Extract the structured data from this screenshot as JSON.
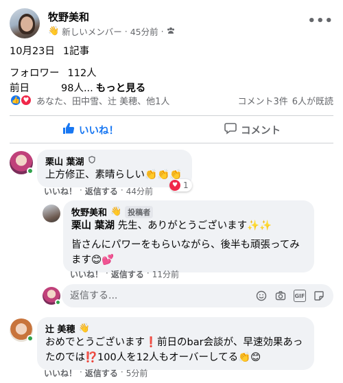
{
  "post": {
    "author": "牧野美和",
    "meta": {
      "member_label": "新しいメンバー",
      "time": "45分前"
    },
    "body": {
      "date": "10月23日",
      "count": "1記事",
      "followers_label": "フォロワー",
      "followers_value": "112人",
      "prev_label": "前日",
      "prev_value": "98人...",
      "see_more": "もっと見る"
    },
    "reactions": {
      "names": "あなた、田中雪、辻 美穂、他1人",
      "comments": "コメント3件",
      "seen": "6人が既読"
    },
    "actions": {
      "like": "いいね！",
      "comment": "コメント"
    }
  },
  "comments": [
    {
      "name": "栗山 葉湖",
      "text": "上方修正、素晴らしい👏👏👏",
      "like": "いいね！",
      "reply": "返信する",
      "time": "44分前",
      "reaction_count": "1"
    },
    {
      "name": "牧野美和",
      "badge": "投稿者",
      "mention": "栗山 葉湖",
      "text1": " 先生、ありがとうございます✨✨",
      "text2": "皆さんにパワーをもらいながら、後半も頑張ってみます😊💕",
      "like": "いいね！",
      "reply": "返信する",
      "time": "11分前"
    },
    {
      "name": "辻 美穂",
      "text": "おめでとうございます❗前日のbar会談が、早速効果あったのでは⁉️100人を12人もオーバーしてる👏😊",
      "like": "いいね！",
      "reply": "返信する",
      "time": "5分前"
    }
  ],
  "reply_input": {
    "placeholder": "返信する..."
  },
  "colors": {
    "accent": "#1877f2",
    "love": "#f02849",
    "online": "#31a24c",
    "bubble": "#f0f2f5"
  }
}
